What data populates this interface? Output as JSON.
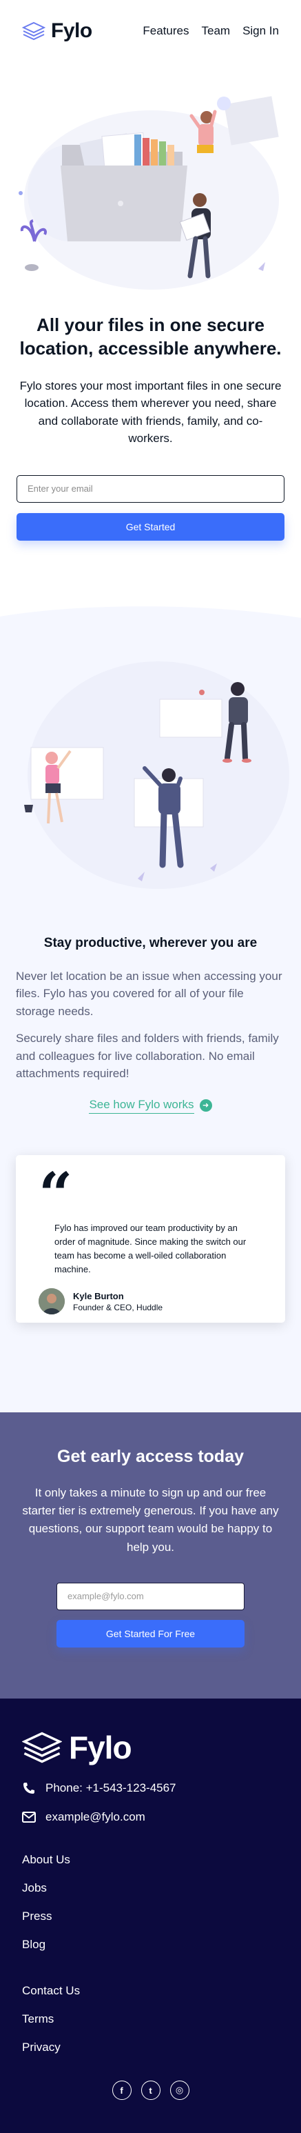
{
  "header": {
    "logo": "Fylo",
    "nav": [
      "Features",
      "Team",
      "Sign In"
    ]
  },
  "hero": {
    "title": "All your files in one secure location, accessible anywhere.",
    "text": "Fylo stores your most important files in one secure location. Access them wherever you need, share and collaborate with friends, family, and co-workers.",
    "email_placeholder": "Enter your email",
    "button": "Get Started"
  },
  "productive": {
    "title": "Stay productive, wherever you are",
    "para1": "Never let location be an issue when accessing your files. Fylo has you covered for all of your file storage needs.",
    "para2": "Securely share files and folders with friends, family and colleagues for live collaboration. No email attachments required!",
    "link": "See how Fylo works"
  },
  "testimonial": {
    "quote_mark": "“",
    "text": "Fylo has improved our team productivity by an order of magnitude. Since making the switch our team has become a well-oiled collaboration machine.",
    "name": "Kyle Burton",
    "title": "Founder & CEO, Huddle"
  },
  "cta": {
    "title": "Get early access today",
    "text": "It only takes a minute to sign up and our free starter tier is extremely generous. If you have any questions, our support team would be happy to help you.",
    "email_placeholder": "example@fylo.com",
    "button": "Get Started For Free"
  },
  "footer": {
    "logo": "Fylo",
    "phone": "Phone: +1-543-123-4567",
    "email": "example@fylo.com",
    "links1": [
      "About Us",
      "Jobs",
      "Press",
      "Blog"
    ],
    "links2": [
      "Contact Us",
      "Terms",
      "Privacy"
    ],
    "socials": [
      {
        "icon": "facebook-icon",
        "glyph": "f"
      },
      {
        "icon": "twitter-icon",
        "glyph": "t"
      },
      {
        "icon": "instagram-icon",
        "glyph": "◎"
      }
    ]
  },
  "colors": {
    "accent_blue": "#3a6dfa",
    "teal": "#3cb595",
    "cta_bg": "#5b5d8f",
    "footer_bg": "#0c0a3e",
    "section_bg": "#f5f7ff"
  }
}
